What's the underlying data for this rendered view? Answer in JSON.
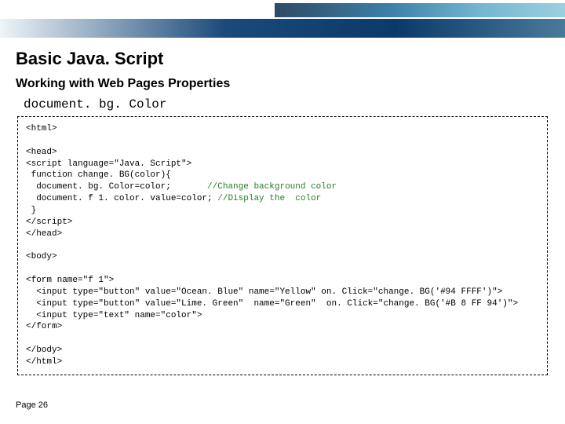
{
  "header": {
    "title": "Basic Java. Script",
    "subtitle": "Working with Web Pages Properties",
    "property": "document. bg. Color"
  },
  "code": {
    "l01": "<html>",
    "l02": "",
    "l03": "<head>",
    "l04": "<script language=\"Java. Script\">",
    "l05": " function change. BG(color){",
    "l06a": "  document. bg. Color=color;       ",
    "l06b": "//Change background color",
    "l07a": "  document. f 1. color. value=color; ",
    "l07b": "//Display the  color",
    "l08": " }",
    "l09": "</script>",
    "l10": "</head>",
    "l11": "",
    "l12": "<body>",
    "l13": "",
    "l14": "<form name=\"f 1\">",
    "l15": "  <input type=\"button\" value=\"Ocean. Blue\" name=\"Yellow\" on. Click=\"change. BG('#94 FFFF')\">",
    "l16": "  <input type=\"button\" value=\"Lime. Green\"  name=\"Green\"  on. Click=\"change. BG('#B 8 FF 94')\">",
    "l17": "  <input type=\"text\" name=\"color\">",
    "l18": "</form>",
    "l19": "",
    "l20": "</body>",
    "l21": "</html>"
  },
  "footer": {
    "page": "Page 26"
  }
}
